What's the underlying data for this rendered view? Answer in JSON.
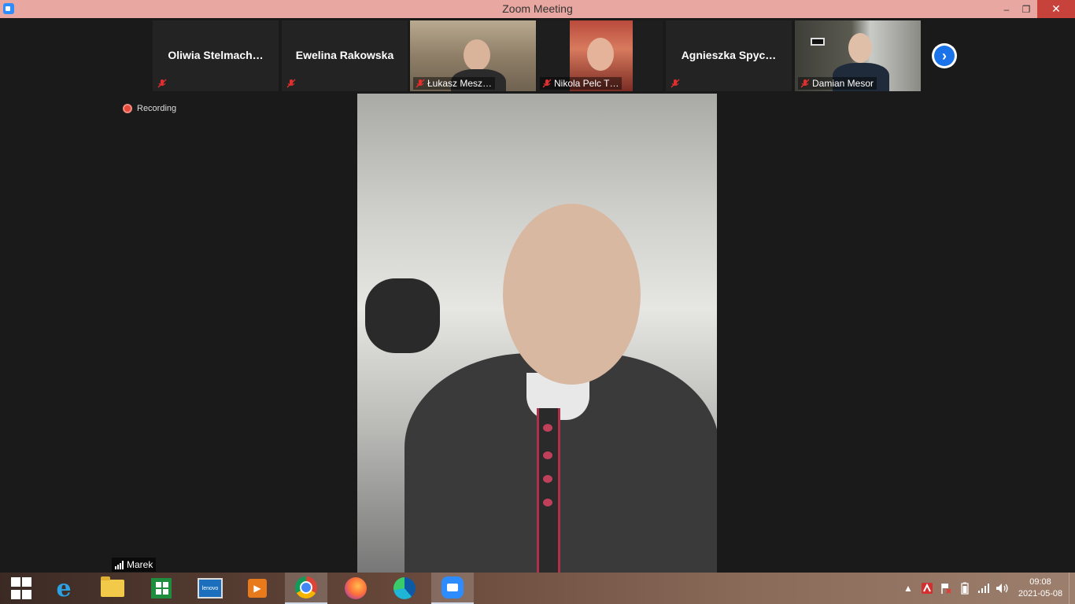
{
  "window": {
    "title": "Zoom Meeting",
    "minimize": "–",
    "maximize": "❐",
    "close": "✕"
  },
  "gallery": {
    "tiles": [
      {
        "name": "Oliwia  Stelmach…",
        "video": false,
        "muted": true
      },
      {
        "name": "Ewelina Rakowska",
        "video": false,
        "muted": true
      },
      {
        "name": "Łukasz Mesz…",
        "video": true,
        "muted": true
      },
      {
        "name": "Nikola Pelc T…",
        "video": true,
        "muted": true
      },
      {
        "name": "Agnieszka  Spyc…",
        "video": false,
        "muted": true
      },
      {
        "name": "Damian Mesor",
        "video": true,
        "muted": true
      }
    ],
    "next_icon": "›"
  },
  "recording": {
    "label": "Recording"
  },
  "active_speaker": {
    "name": "Marek"
  },
  "taskbar": {
    "apps": [
      "start-icon",
      "internet-explorer-icon",
      "file-explorer-icon",
      "store-icon",
      "lenovo-icon",
      "media-player-icon",
      "chrome-icon",
      "firefox-icon",
      "edge-icon",
      "zoom-icon"
    ],
    "lenovo_text": "lenovo",
    "tray": {
      "expand": "▲",
      "time": "09:08",
      "date": "2021-05-08"
    }
  },
  "colors": {
    "titlebar": "#e8a7a1",
    "close_button": "#c7423a",
    "zoom_blue": "#2d8cff",
    "recording_red": "#e54b3c",
    "muted_red": "#e02f2f"
  }
}
